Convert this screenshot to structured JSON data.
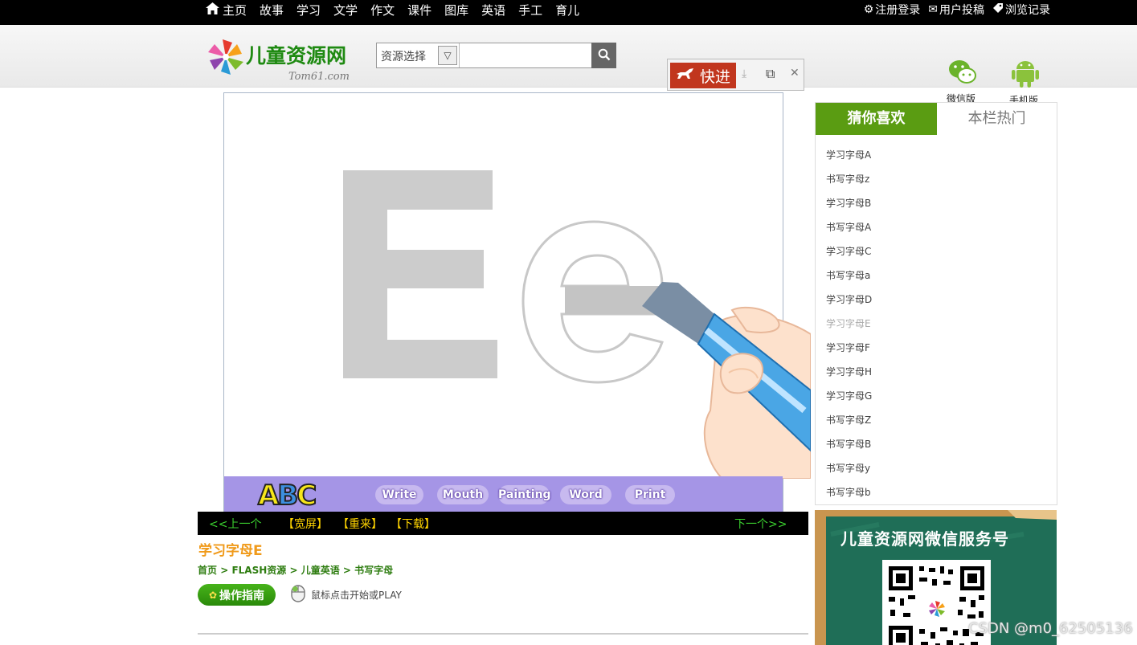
{
  "topnav": {
    "items": [
      "主页",
      "故事",
      "学习",
      "文学",
      "作文",
      "课件",
      "图库",
      "英语",
      "手工",
      "育儿"
    ]
  },
  "toplinks": {
    "register": "注册登录",
    "submit": "用户投稿",
    "history": "浏览记录"
  },
  "logo": {
    "title": "儿童资源网",
    "subtitle": "Tom61.com"
  },
  "search": {
    "select_label": "资源选择",
    "value": "",
    "placeholder": ""
  },
  "quickbar": {
    "label": "快进"
  },
  "apps": {
    "wechat": "微信版",
    "mobile": "手机版"
  },
  "flash": {
    "letter_upper": "E",
    "letter_lower": "e",
    "abc": [
      "A",
      "B",
      "C"
    ],
    "tools": [
      "Write",
      "Mouth",
      "Painting",
      "Word",
      "Print"
    ]
  },
  "controls": {
    "prev": "<<上一个",
    "wide": "【宽屏】",
    "restart": "【重来】",
    "download": "【下载】",
    "next": "下一个>>"
  },
  "resource": {
    "title": "学习字母E",
    "breadcrumb": [
      "首页",
      "FLASH资源",
      "儿童英语",
      "书写字母"
    ],
    "breadcrumb_sep": " > ",
    "guide_button": "操作指南",
    "hint": "鼠标点击开始或PLAY"
  },
  "sidebar": {
    "tab_guess": "猜你喜欢",
    "tab_hot": "本栏热门",
    "items": [
      "学习字母A",
      "书写字母z",
      "学习字母B",
      "书写字母A",
      "学习字母C",
      "书写字母a",
      "学习字母D",
      "学习字母E",
      "学习字母F",
      "学习字母H",
      "学习字母G",
      "书写字母Z",
      "书写字母B",
      "书写字母y",
      "书写字母b"
    ],
    "active_index": 7
  },
  "wechat_banner": {
    "title": "儿童资源网微信服务号"
  },
  "watermark": "CSDN @m0_62505136",
  "colors": {
    "accent_green": "#5a9c12",
    "title_orange": "#f09a1a",
    "quick_red": "#c1361e",
    "toolbar_purple": "#a595e6"
  }
}
